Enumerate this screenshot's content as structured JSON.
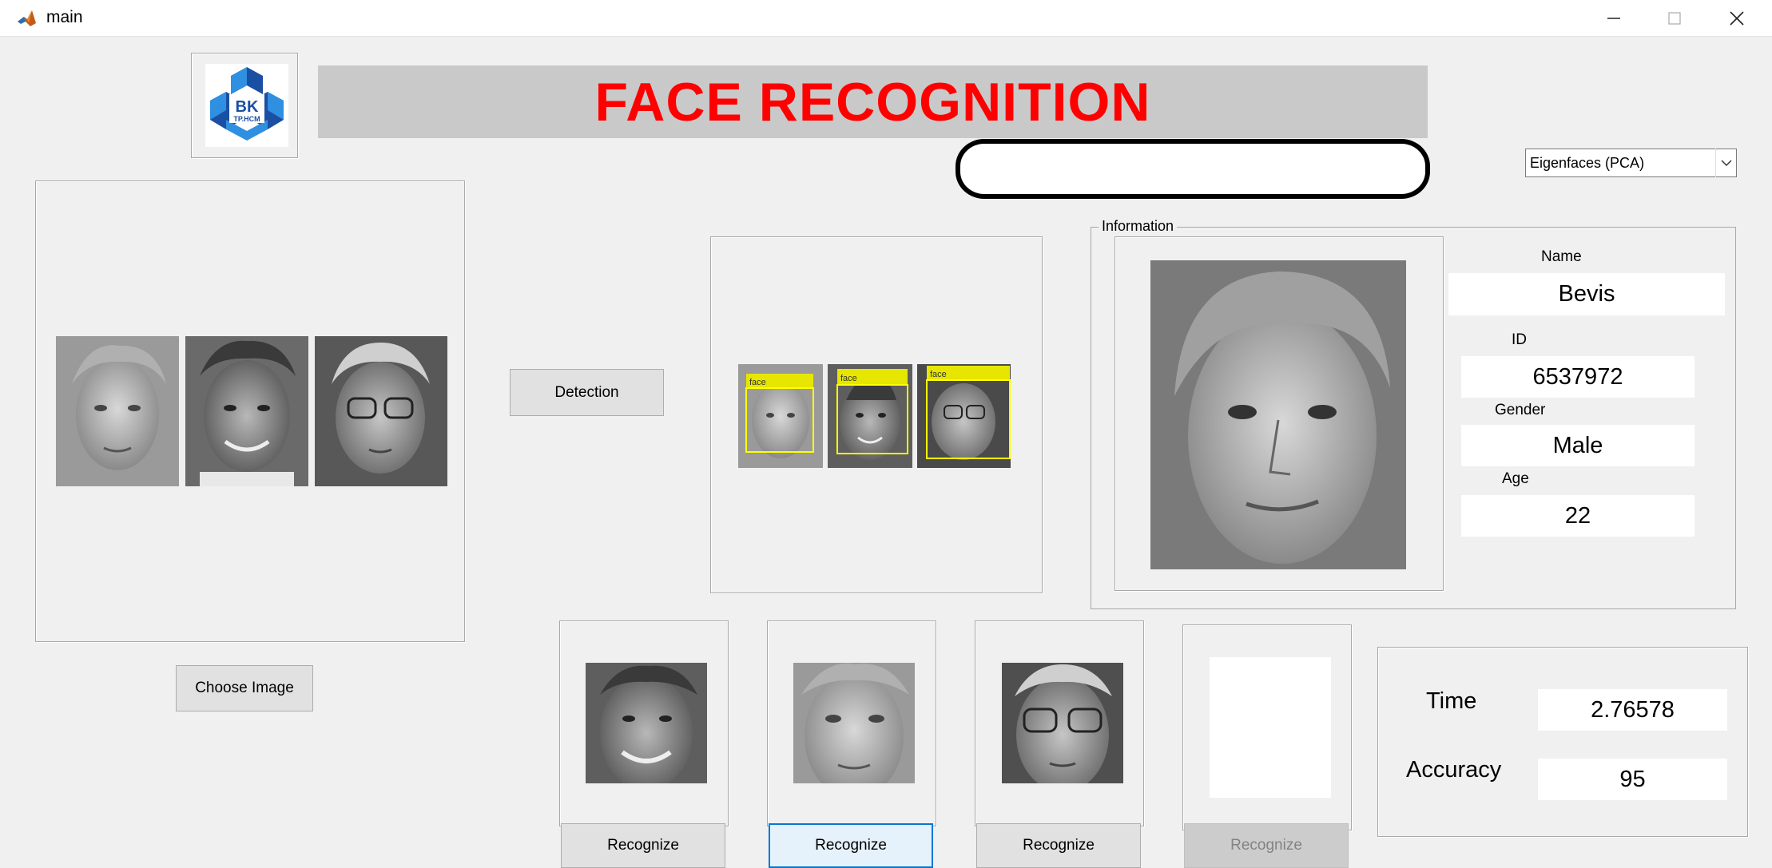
{
  "window": {
    "title": "main",
    "app_icon": "matlab-icon",
    "controls": [
      "minimize-icon",
      "maximize-icon",
      "close-icon"
    ]
  },
  "header": {
    "banner_title": "FACE RECOGNITION",
    "logo_text": "BK",
    "logo_subtext": "TP.HCM",
    "status_text": ""
  },
  "method_select": {
    "selected": "Eigenfaces (PCA)"
  },
  "buttons": {
    "choose_image": "Choose Image",
    "detection": "Detection",
    "recognize": [
      "Recognize",
      "Recognize",
      "Recognize",
      "Recognize"
    ]
  },
  "detection": {
    "box_label": "face"
  },
  "information": {
    "title": "Information",
    "name_label": "Name",
    "name_value": "Bevis",
    "id_label": "ID",
    "id_value": "6537972",
    "gender_label": "Gender",
    "gender_value": "Male",
    "age_label": "Age",
    "age_value": "22"
  },
  "stats": {
    "time_label": "Time",
    "time_value": "2.76578",
    "accuracy_label": "Accuracy",
    "accuracy_value": "95"
  },
  "colors": {
    "banner_text": "#ff0000",
    "banner_bg": "#c9c9c9",
    "detection_box": "#ffff00",
    "logo_blue": "#1b4fa3",
    "logo_light_blue": "#2f8fe0"
  }
}
